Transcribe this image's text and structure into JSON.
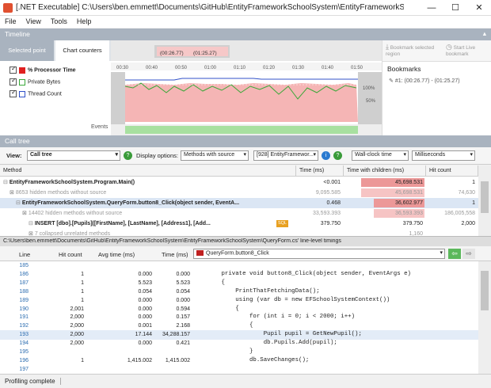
{
  "window": {
    "title": "[.NET Executable] C:\\Users\\ben.emmett\\Documents\\GitHub\\EntityFrameworkSchoolSystem\\EntityFrameworkSchoolSystem...",
    "minimize": "—",
    "maximize": "☐",
    "close": "✕"
  },
  "menu": [
    "File",
    "View",
    "Tools",
    "Help"
  ],
  "timeline": {
    "header": "Timeline",
    "tab_selected_point": "Selected point",
    "tab_chart_counters": "Chart counters",
    "counters": [
      {
        "label": "% Processor Time",
        "color": "#e02020"
      },
      {
        "label": "Private Bytes",
        "color": "#38a838"
      },
      {
        "label": "Thread Count",
        "color": "#3050c8"
      }
    ],
    "ticks": [
      "00:30",
      "00:40",
      "00:50",
      "01:00",
      "01:10",
      "01:20",
      "01:30",
      "01:40",
      "01:50"
    ],
    "selection_start": "(00:26.77)",
    "selection_end": "(01:25.27)",
    "pct100": "100%",
    "pct50": "50%",
    "events_label": "Events",
    "bookmark_selected": "Bookmark selected region",
    "start_live": "Start Live bookmark"
  },
  "bookmarks": {
    "title": "Bookmarks",
    "item": "#1: (00:26.77) - (01:25.27)"
  },
  "calltree": {
    "header": "Call tree",
    "view_label": "View:",
    "view_value": "Call tree",
    "display_options_label": "Display options:",
    "display_value": "Methods with source",
    "process": "[928] EntityFramewor...",
    "timing": "Wall-clock time",
    "units": "Milliseconds",
    "columns": [
      "Method",
      "Time (ms)",
      "Time with children (ms)",
      "Hit count"
    ],
    "rows": [
      {
        "method": "EntityFrameworkSchoolSystem.Program.Main()",
        "time": "<0.001",
        "twc": "45,698.531",
        "hits": "1",
        "bar": 1.0,
        "indent": 0,
        "bold": true
      },
      {
        "method": "8653 hidden methods without source",
        "time": "9,095.585",
        "twc": "45,698.531",
        "hits": "74,630",
        "bar": 1.0,
        "indent": 1,
        "gray": true
      },
      {
        "method": "EntityFrameworkSchoolSystem.QueryForm.button8_Click(object sender, EventA...",
        "time": "0.468",
        "twc": "36,602.977",
        "hits": "1",
        "bar": 0.8,
        "indent": 2,
        "bold": true,
        "selected": true
      },
      {
        "method": "14402 hidden methods without source",
        "time": "33,593.393",
        "twc": "36,593.393",
        "hits": "186,005,558",
        "bar": 0.8,
        "indent": 3,
        "gray": true
      },
      {
        "method": "INSERT [dbo].[Pupils]([FirstName], [LastName], [Address1], [Add...",
        "time": "379.750",
        "twc": "379.750",
        "hits": "2,000",
        "bar": 0.0,
        "indent": 4,
        "bold": true,
        "sql": "SQL"
      },
      {
        "method": "7 collapsed unrelated methods",
        "time": "",
        "twc": "1,160",
        "hits": "",
        "bar": 0.0,
        "indent": 4,
        "gray": true
      }
    ]
  },
  "source": {
    "path": "C:\\Users\\ben.emmett\\Documents\\GitHub\\EntityFrameworkSchoolSystem\\EntityFrameworkSchoolSystem\\QueryForm.cs' line-level timings",
    "columns": [
      "Line",
      "Hit count",
      "Avg time (ms)",
      "Time (ms)"
    ],
    "method": "QueryForm.button8_Click",
    "lines": [
      {
        "ln": "185",
        "hits": "",
        "avg": "",
        "time": "",
        "code": ""
      },
      {
        "ln": "186",
        "hits": "1",
        "avg": "0.000",
        "time": "0.000",
        "code": "        private void button8_Click(object sender, EventArgs e)"
      },
      {
        "ln": "187",
        "hits": "1",
        "avg": "5.523",
        "time": "5.523",
        "code": "        {"
      },
      {
        "ln": "188",
        "hits": "1",
        "avg": "0.054",
        "time": "0.054",
        "code": "            PrintThatFetchingData();"
      },
      {
        "ln": "189",
        "hits": "1",
        "avg": "0.000",
        "time": "0.000",
        "code": "            using (var db = new EFSchoolSystemContext())"
      },
      {
        "ln": "190",
        "hits": "2,001",
        "avg": "0.000",
        "time": "0.594",
        "code": "            {"
      },
      {
        "ln": "191",
        "hits": "2,000",
        "avg": "0.000",
        "time": "0.157",
        "code": "                for (int i = 0; i < 2000; i++)"
      },
      {
        "ln": "192",
        "hits": "2,000",
        "avg": "0.001",
        "time": "2.168",
        "code": "                {"
      },
      {
        "ln": "193",
        "hits": "2,000",
        "avg": "17.144",
        "time": "34,288.157",
        "code": "                    Pupil pupil = GetNewPupil();"
      },
      {
        "ln": "194",
        "hits": "2,000",
        "avg": "0.000",
        "time": "0.421",
        "code": "                    db.Pupils.Add(pupil);"
      },
      {
        "ln": "195",
        "hits": "",
        "avg": "",
        "time": "",
        "code": "                }"
      },
      {
        "ln": "196",
        "hits": "1",
        "avg": "1,415.002",
        "time": "1,415.002",
        "code": "                db.SaveChanges();"
      },
      {
        "ln": "197",
        "hits": "",
        "avg": "",
        "time": "",
        "code": ""
      }
    ]
  },
  "status": "Profiling complete"
}
